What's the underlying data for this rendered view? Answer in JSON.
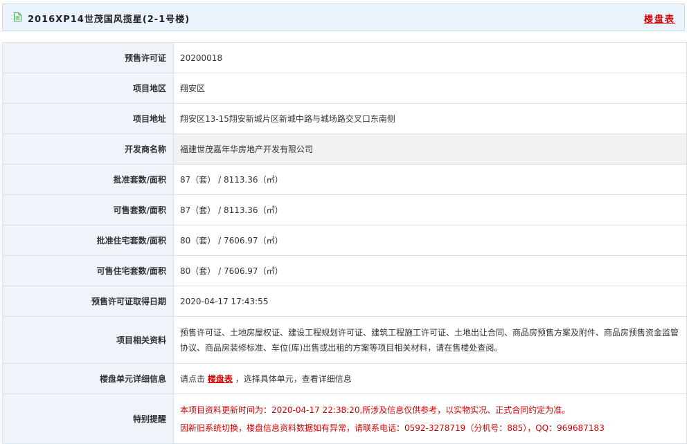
{
  "header": {
    "title": "2016XP14世茂国风揽星(2-1号楼)",
    "link_label": "楼盘表"
  },
  "rows": [
    {
      "label": "预售许可证",
      "value": "20200018"
    },
    {
      "label": "项目地区",
      "value": "翔安区"
    },
    {
      "label": "项目地址",
      "value": "翔安区13-15翔安新城片区新城中路与城场路交叉口东南侧"
    },
    {
      "label": "开发商名称",
      "value": "福建世茂嘉年华房地产开发有限公司"
    },
    {
      "label": "批准套数/面积",
      "value": "87（套） / 8113.36（㎡）"
    },
    {
      "label": "可售套数/面积",
      "value": "87（套） / 8113.36（㎡）"
    },
    {
      "label": "批准住宅套数/面积",
      "value": "80（套） / 7606.97（㎡）"
    },
    {
      "label": "可售住宅套数/面积",
      "value": "80（套） / 7606.97（㎡）"
    },
    {
      "label": "预售许可证取得日期",
      "value": "2020-04-17 17:43:55"
    },
    {
      "label": "项目相关资料",
      "value": "预售许可证、土地房屋权证、建设工程规划许可证、建筑工程施工许可证、土地出让合同、商品房预售方案及附件、商品房预售资金监管协议、商品房装修标准、车位(库)出售或出租的方案等项目相关材料，请在售楼处查阅。"
    }
  ],
  "detail_row": {
    "label": "楼盘单元详细信息",
    "prefix": "请点击",
    "link": "楼盘表",
    "suffix": "，选择具体单元，查看详细信息"
  },
  "notice_row": {
    "label": "特别提醒",
    "line1": "本项目资料更新时间为：2020-04-17 22:38:20,所涉及信息仅供参考，以实物实况、正式合同约定为准。",
    "line2": "因新旧系统切换，楼盘信息资料数据如有异常，请联系电话：0592-3278719（分机号：885），QQ：969687183"
  },
  "colors": {
    "accent_red": "#d40000",
    "label_bg": "#eef4fa",
    "header_bg": "#eaf3fb"
  },
  "icons": {
    "title_icon": "document-icon"
  }
}
